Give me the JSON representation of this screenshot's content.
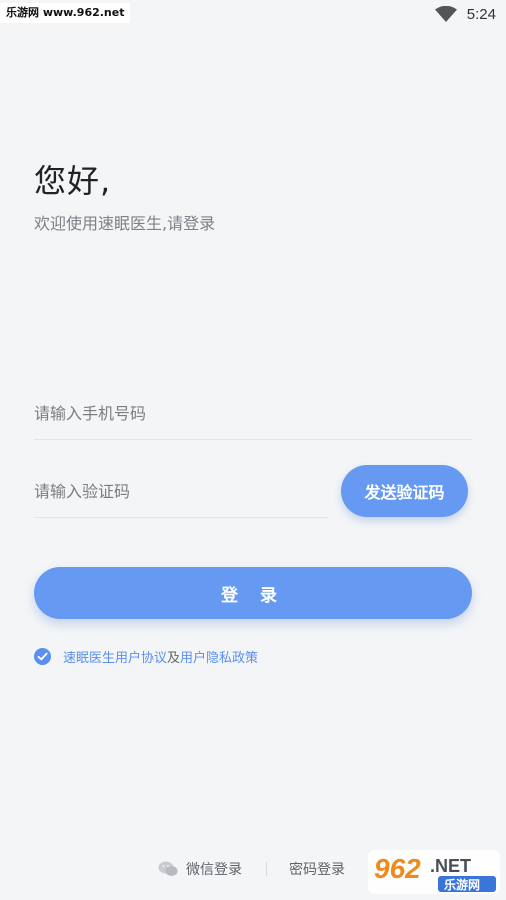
{
  "status_bar": {
    "watermark_tag": "乐游网 www.962.net",
    "time": "5:24"
  },
  "header": {
    "greeting": "您好,",
    "subtitle": "欢迎使用速眠医生,请登录"
  },
  "form": {
    "phone_placeholder": "请输入手机号码",
    "code_placeholder": "请输入验证码",
    "send_code_label": "发送验证码",
    "login_label": "登 录"
  },
  "agreement": {
    "checked": true,
    "link_user_agreement": "速眠医生用户协议",
    "connector": "及",
    "link_privacy_policy": "用户隐私政策"
  },
  "alt_login": {
    "wechat_label": "微信登录",
    "password_label": "密码登录"
  },
  "watermark_logo": {
    "text_main": "962",
    "text_suffix": ".NET",
    "text_sub": "乐游网"
  },
  "colors": {
    "primary": "#6699f2",
    "link": "#5b8ff0",
    "background": "#f3f5f7"
  },
  "icons": [
    "wifi-icon",
    "check-icon",
    "wechat-icon"
  ]
}
